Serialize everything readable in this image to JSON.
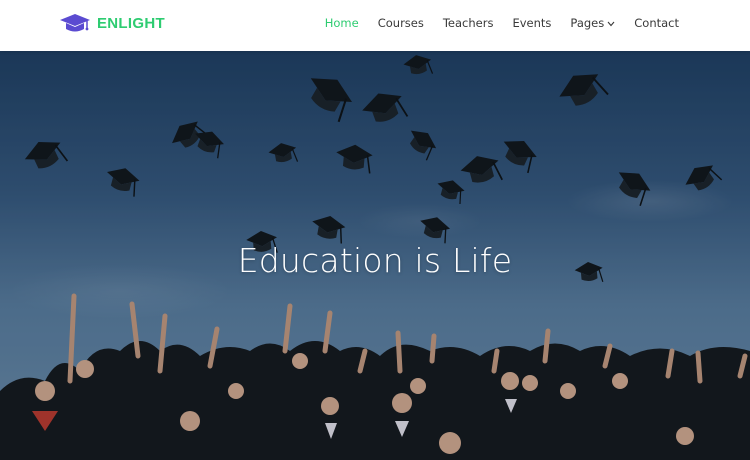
{
  "brand": {
    "name": "ENLIGHT",
    "icon": "graduation-cap-icon",
    "color": "#2ecc71"
  },
  "nav": {
    "items": [
      {
        "label": "Home",
        "active": true
      },
      {
        "label": "Courses",
        "active": false
      },
      {
        "label": "Teachers",
        "active": false
      },
      {
        "label": "Events",
        "active": false
      },
      {
        "label": "Pages",
        "active": false,
        "dropdown": true
      },
      {
        "label": "Contact",
        "active": false
      }
    ],
    "active_color": "#2ecc71",
    "text_color": "#3a3a3a"
  },
  "hero": {
    "title": "Education is Life",
    "image": "graduates-throwing-caps-photo"
  }
}
